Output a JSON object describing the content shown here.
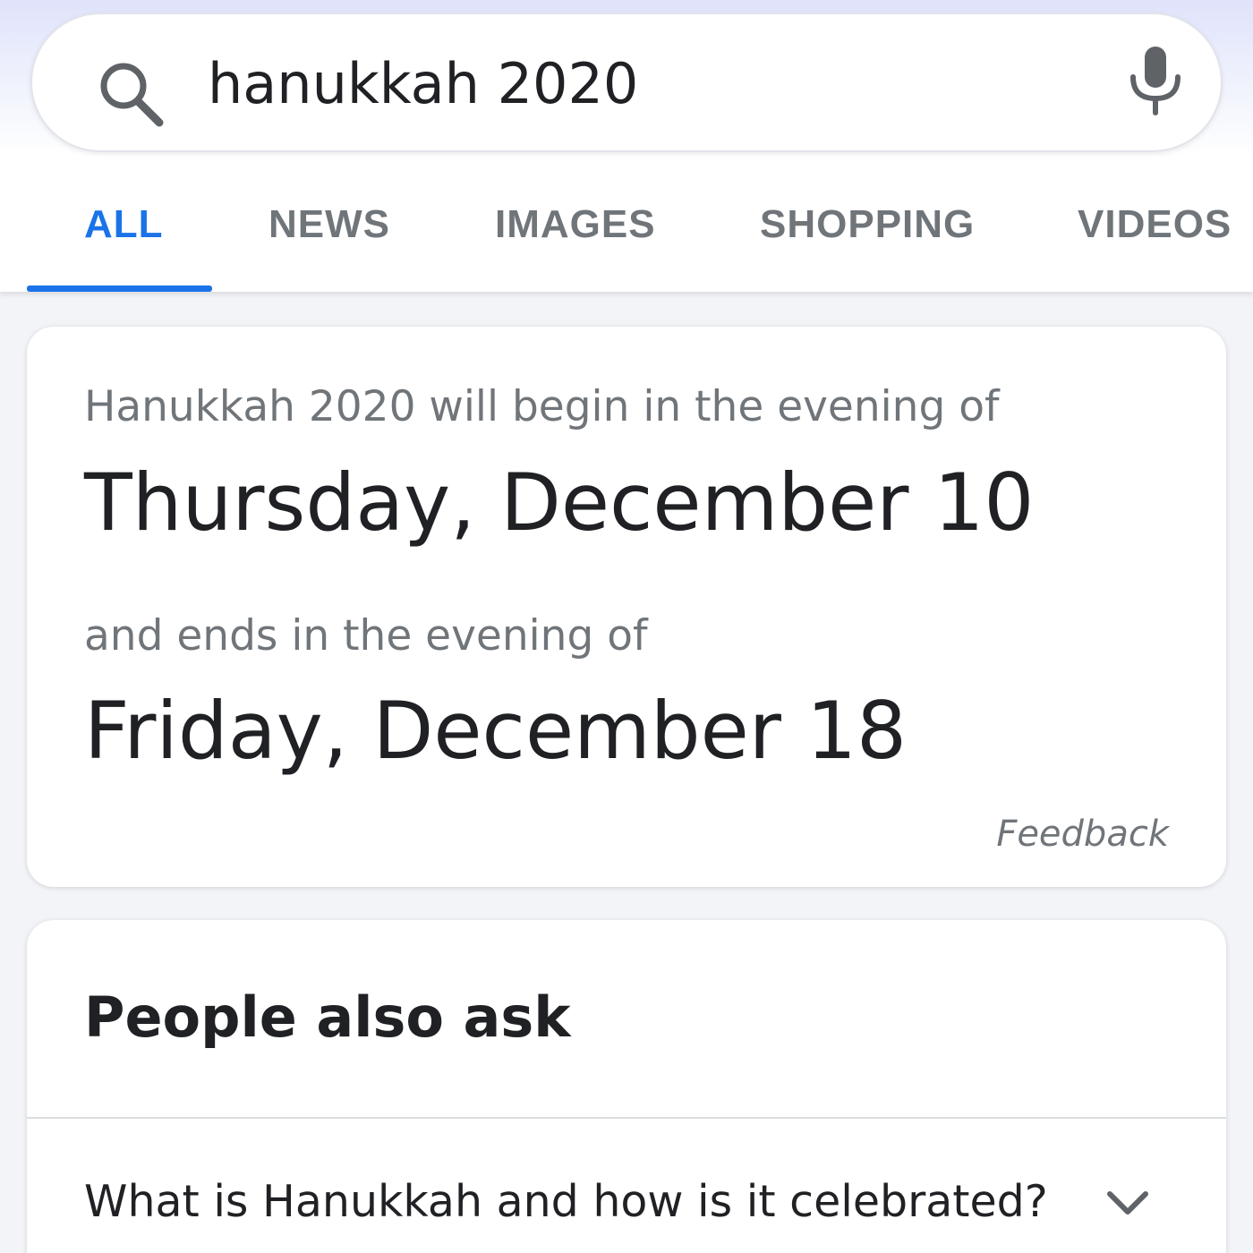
{
  "search": {
    "query": "hanukkah 2020",
    "left_icon": "search-icon",
    "right_icon": "mic-icon"
  },
  "tabs": [
    {
      "label": "ALL",
      "active": true
    },
    {
      "label": "NEWS",
      "active": false
    },
    {
      "label": "IMAGES",
      "active": false
    },
    {
      "label": "SHOPPING",
      "active": false
    },
    {
      "label": "VIDEOS",
      "active": false
    }
  ],
  "answer": {
    "intro": "Hanukkah 2020 will begin in the evening of",
    "start_date": "Thursday, December 10",
    "middle": "and ends in the evening of",
    "end_date": "Friday, December 18",
    "feedback_label": "Feedback"
  },
  "people_also_ask": {
    "title": "People also ask",
    "questions": [
      {
        "text": "What is Hanukkah and how is it celebrated?",
        "icon": "chevron-down-icon"
      }
    ]
  },
  "colors": {
    "accent": "#1a73e8",
    "text_primary": "#202124",
    "text_secondary": "#70757a"
  }
}
